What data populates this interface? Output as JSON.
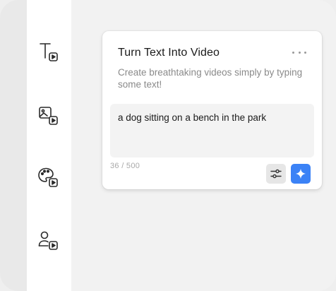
{
  "colors": {
    "accent": "#3b82f6",
    "sidebar_bg": "#ffffff",
    "content_bg": "#f2f2f2",
    "icon_stroke": "#2a2a2a"
  },
  "sidebar": {
    "items": [
      {
        "icon": "text-to-video-icon"
      },
      {
        "icon": "image-to-video-icon"
      },
      {
        "icon": "palette-video-icon"
      },
      {
        "icon": "avatar-video-icon"
      }
    ]
  },
  "card": {
    "title": "Turn Text Into Video",
    "description": "Create breathtaking videos simply by typing some text!",
    "prompt_value": "a dog sitting on a bench in the park",
    "char_count": "36 / 500",
    "more_icon": "ellipsis-icon",
    "settings_icon": "sliders-icon",
    "generate_icon": "sparkle-icon"
  }
}
